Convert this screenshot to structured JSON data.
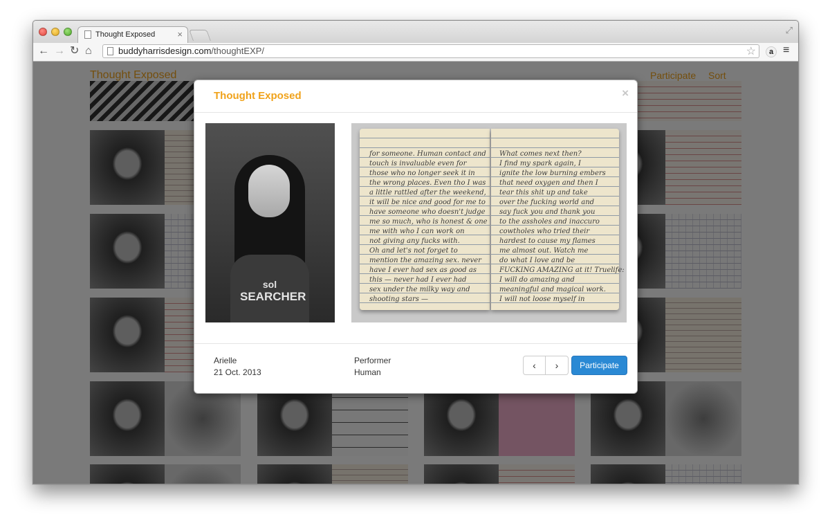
{
  "browser": {
    "tab_title": "Thought Exposed",
    "tab_close": "×",
    "url_domain": "buddyharrisdesign.com",
    "url_path": "/thoughtEXP/",
    "icons": [
      "back-arrow-icon",
      "forward-arrow-icon",
      "reload-icon",
      "home-icon",
      "bookmark-star-icon",
      "amazon-extension-icon",
      "menu-icon",
      "fullscreen-icon"
    ]
  },
  "site": {
    "brand": "Thought Exposed",
    "nav": [
      "Participate",
      "Sort"
    ],
    "accent_color": "#e89c18"
  },
  "modal": {
    "title": "Thought Exposed",
    "close": "×",
    "shirt_line1": "sol",
    "shirt_line2": "SEARCHER",
    "notebook_left": [
      "for someone. Human contact and",
      "touch is invaluable even for",
      "those who no longer seek it in",
      "the wrong places. Even tho I was",
      "a little rattled after the weekend,",
      "it will be nice and good for me to",
      "have someone who doesn't judge",
      "me so much, who is honest & one",
      "me with who I can work on",
      "not giving any fucks with.",
      "Oh and let's not forget to",
      "mention the amazing sex. never",
      "have I ever had sex as good as",
      "this — never had I ever had",
      "sex under the milky way and",
      "shooting stars —"
    ],
    "notebook_right": [
      "What comes next then?",
      "I find my spark again, I",
      "ignite the low burning embers",
      "that need oxygen and then I",
      "tear this shit up and take",
      "over the fucking world and",
      "say fuck you and thank you",
      "to the assholes and inaccuro",
      "cowtholes who tried their",
      "hardest to cause my flames",
      "me almost out. Watch me",
      "do what I love and be",
      "FUCKING AMAZING at it! Truelife:",
      "I will do amazing and",
      "meaningful and magical work.",
      "I will not loose myself in"
    ],
    "name": "Arielle",
    "date": "21 Oct. 2013",
    "role": "Performer",
    "role_value": "Human",
    "prev_icon": "‹",
    "next_icon": "›",
    "participate_label": "Participate",
    "button_color": "#2a89d4"
  }
}
